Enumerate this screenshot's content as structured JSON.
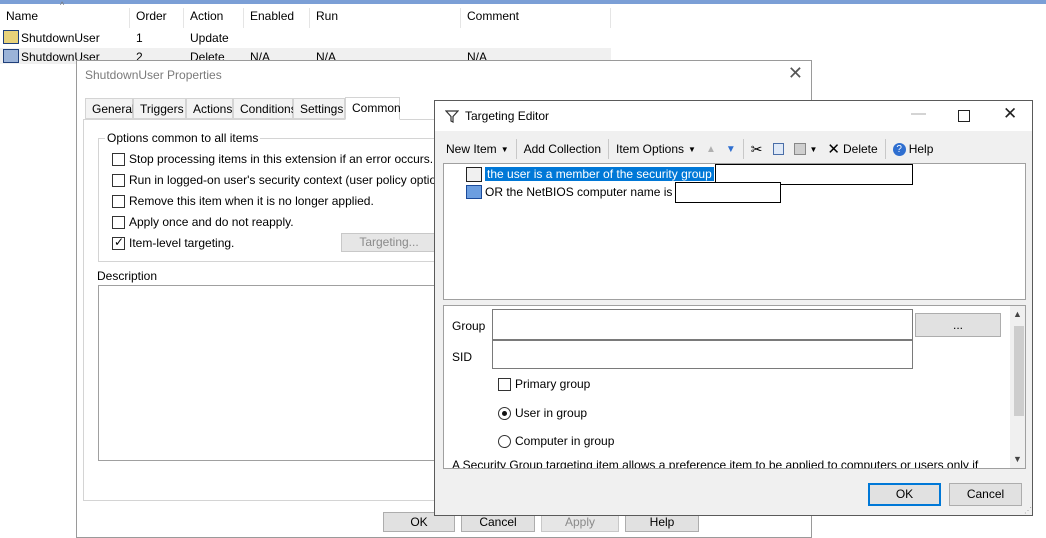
{
  "list": {
    "headers": [
      "Name",
      "Order",
      "Action",
      "Enabled",
      "Run",
      "Comment"
    ],
    "rows": [
      {
        "name": "ShutdownUser",
        "order": "1",
        "action": "Update",
        "enabled": "",
        "run": "",
        "comment": ""
      },
      {
        "name": "ShutdownUser",
        "order": "2",
        "action": "Delete",
        "enabled": "N/A",
        "run": "N/A",
        "comment": "N/A"
      }
    ]
  },
  "props": {
    "title": "ShutdownUser Properties",
    "tabs": [
      "General",
      "Triggers",
      "Actions",
      "Conditions",
      "Settings",
      "Common"
    ],
    "group_title": "Options common to all items",
    "options": [
      {
        "label": "Stop processing items in this extension if an error occurs.",
        "checked": false
      },
      {
        "label": "Run in logged-on user's security context (user policy option).",
        "checked": false
      },
      {
        "label": "Remove this item when it is no longer applied.",
        "checked": false
      },
      {
        "label": "Apply once and do not reapply.",
        "checked": false
      },
      {
        "label": "Item-level targeting.",
        "checked": true
      }
    ],
    "targeting_button": "Targeting...",
    "description_label": "Description",
    "buttons": {
      "ok": "OK",
      "cancel": "Cancel",
      "apply": "Apply",
      "help": "Help"
    }
  },
  "targeting": {
    "title": "Targeting Editor",
    "toolbar": {
      "new_item": "New Item",
      "add_collection": "Add Collection",
      "item_options": "Item Options",
      "delete": "Delete",
      "help": "Help"
    },
    "tree": [
      {
        "text": "the user is a member of the security group",
        "selected": true
      },
      {
        "text": "OR the NetBIOS computer name is",
        "selected": false
      }
    ],
    "fields": {
      "group": "Group",
      "sid": "SID",
      "browse": "..."
    },
    "primary_group": "Primary group",
    "radios": [
      {
        "label": "User in group",
        "selected": true
      },
      {
        "label": "Computer in group",
        "selected": false
      }
    ],
    "help_text": "A Security Group targeting item allows a preference item to be applied to computers or users only if",
    "buttons": {
      "ok": "OK",
      "cancel": "Cancel"
    }
  }
}
